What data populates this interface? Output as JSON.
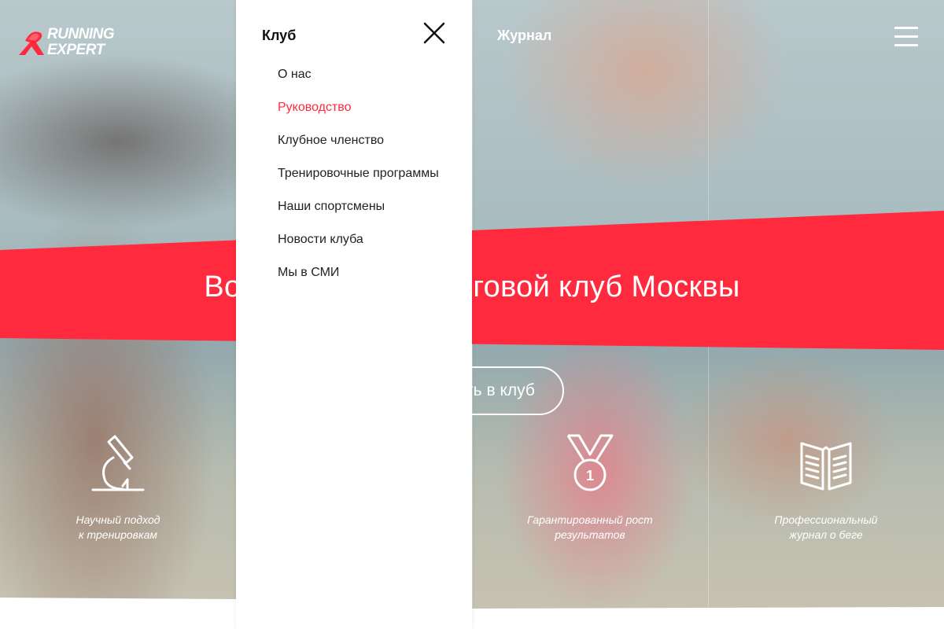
{
  "brand": {
    "line1": "RUNNING",
    "line2": "EXPERT",
    "accent_color": "#ff2a3d"
  },
  "nav": {
    "club_label": "Клуб",
    "journal_label": "Журнал",
    "menu_icon": "hamburger-icon",
    "close_icon": "close-icon"
  },
  "dropdown": {
    "items": [
      {
        "label": "О нас"
      },
      {
        "label": "Руководство",
        "active": true
      },
      {
        "label": "Клубное членство"
      },
      {
        "label": "Тренировочные программы"
      },
      {
        "label": "Наши спортсмены"
      },
      {
        "label": "Новости клуба"
      },
      {
        "label": "Мы в СМИ"
      }
    ]
  },
  "hero": {
    "headline": "Возглавляющий беговой клуб Москвы",
    "join_button_label": "Вступить в клуб"
  },
  "features": [
    {
      "line1": "Научный подход",
      "line2": "к тренировкам",
      "icon": "microscope-icon"
    },
    {
      "line1": "Гарантированный рост",
      "line2": "результатов",
      "icon": "medal-icon"
    },
    {
      "line1": "Профессиональный",
      "line2": "журнал о беге",
      "icon": "open-book-icon"
    }
  ],
  "medal_number": "1"
}
